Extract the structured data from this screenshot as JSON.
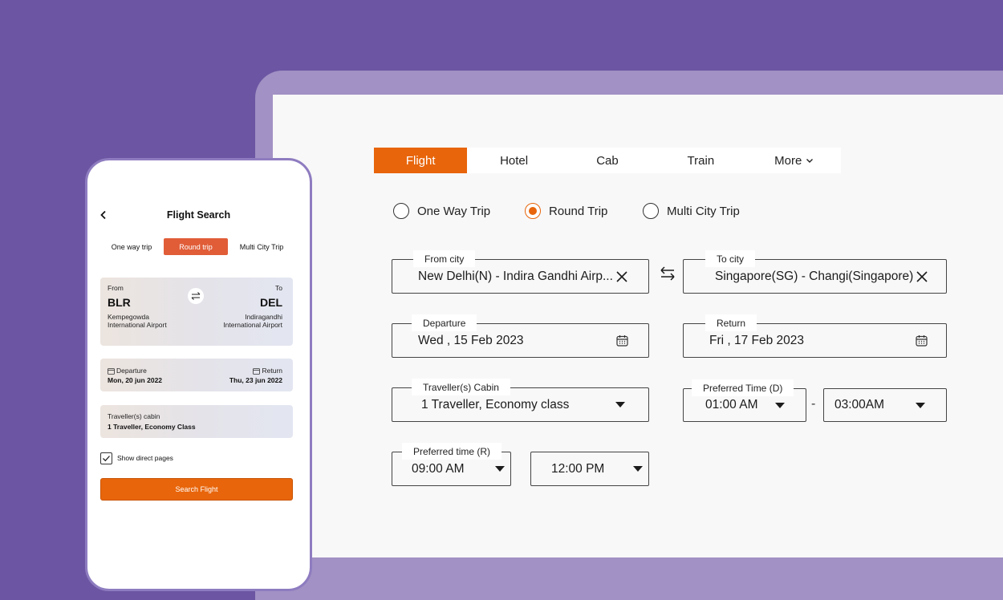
{
  "desktop": {
    "tabs": [
      {
        "label": "Flight"
      },
      {
        "label": "Hotel"
      },
      {
        "label": "Cab"
      },
      {
        "label": "Train"
      },
      {
        "label": "More"
      }
    ],
    "trip_types": [
      {
        "label": "One Way Trip",
        "checked": false
      },
      {
        "label": "Round Trip",
        "checked": true
      },
      {
        "label": "Multi City Trip",
        "checked": false
      }
    ],
    "from_city": {
      "label": "From city",
      "value": "New Delhi(N) - Indira Gandhi Airp..."
    },
    "to_city": {
      "label": "To city",
      "value": "Singapore(SG) - Changi(Singapore)"
    },
    "departure": {
      "label": "Departure",
      "value": "Wed , 15 Feb 2023"
    },
    "return": {
      "label": "Return",
      "value": "Fri , 17 Feb 2023"
    },
    "cabin": {
      "label": "Traveller(s) Cabin",
      "value": "1 Traveller, Economy class"
    },
    "pref_time_d": {
      "label": "Preferred Time (D)",
      "from": "01:00 AM",
      "to": "03:00AM",
      "separator": "-"
    },
    "pref_time_r": {
      "label": "Preferred time (R)",
      "from": "09:00 AM",
      "to": "12:00 PM"
    }
  },
  "phone": {
    "title": "Flight Search",
    "trip_types": [
      {
        "label": "One way trip",
        "active": false
      },
      {
        "label": "Round trip",
        "active": true
      },
      {
        "label": "Multi City Trip",
        "active": false
      }
    ],
    "from": {
      "caption": "From",
      "code": "BLR",
      "airport_line1": "Kempegowda",
      "airport_line2": "International Airport"
    },
    "to": {
      "caption": "To",
      "code": "DEL",
      "airport_line1": "Indiragandhi",
      "airport_line2": "International Airport"
    },
    "departure": {
      "label": "Departure",
      "value": "Mon, 20 jun 2022"
    },
    "return": {
      "label": "Return",
      "value": "Thu, 23 jun 2022"
    },
    "cabin": {
      "label": "Traveller(s) cabin",
      "value": "1 Traveller, Economy Class"
    },
    "direct_checkbox": {
      "label": "Show direct pages",
      "checked": true
    },
    "search_button": "Search Flight"
  },
  "colors": {
    "background": "#6c56a3",
    "accent": "#e8650b",
    "phone_tab_active": "#e05d38"
  }
}
